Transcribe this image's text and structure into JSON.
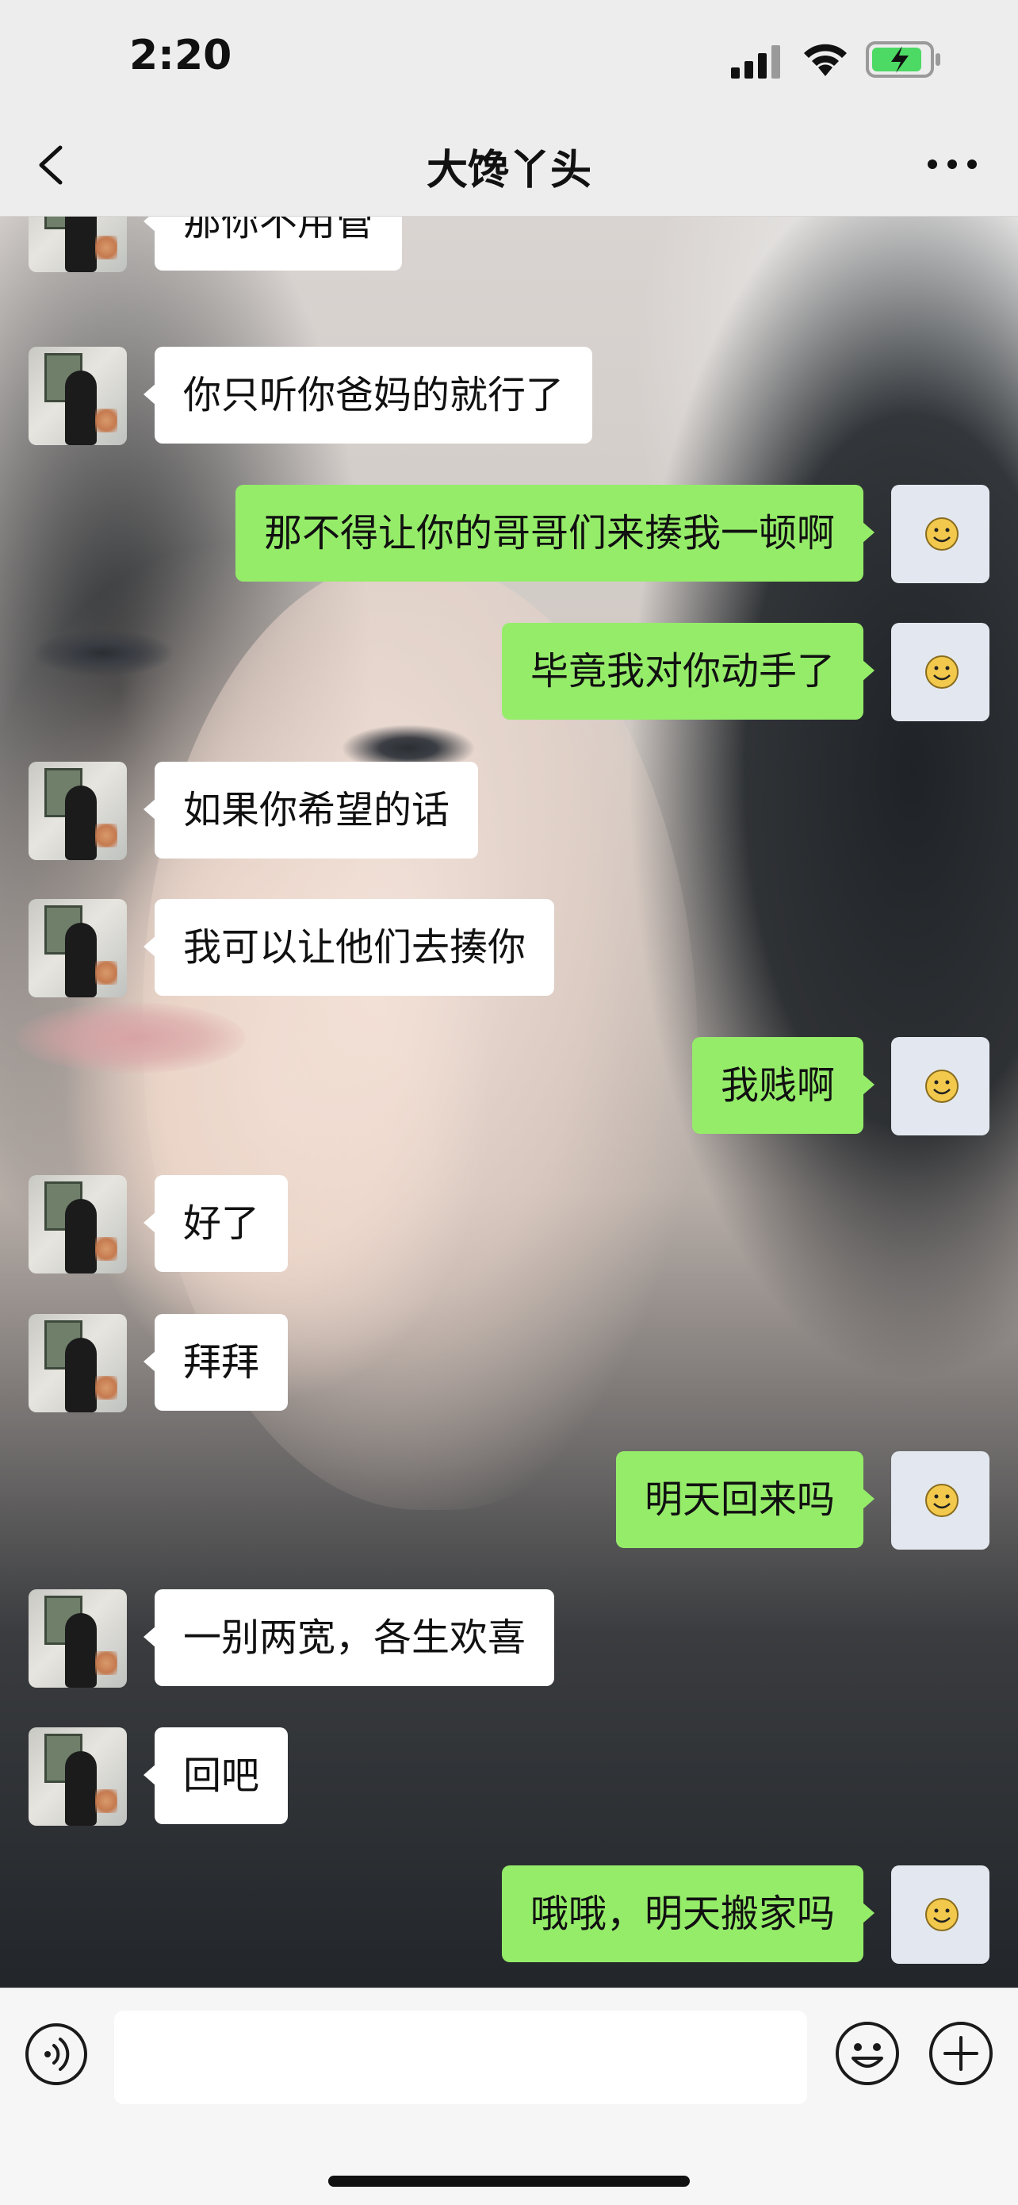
{
  "status_bar": {
    "time": "2:20"
  },
  "header": {
    "title": "大馋丫头"
  },
  "messages": [
    {
      "side": "theirs",
      "text": "那你不用管"
    },
    {
      "side": "theirs",
      "text": "你只听你爸妈的就行了"
    },
    {
      "side": "mine",
      "text": "那不得让你的哥哥们来揍我一顿啊"
    },
    {
      "side": "mine",
      "text": "毕竟我对你动手了"
    },
    {
      "side": "theirs",
      "text": "如果你希望的话"
    },
    {
      "side": "theirs",
      "text": "我可以让他们去揍你"
    },
    {
      "side": "mine",
      "text": "我贱啊"
    },
    {
      "side": "theirs",
      "text": "好了"
    },
    {
      "side": "theirs",
      "text": "拜拜"
    },
    {
      "side": "mine",
      "text": "明天回来吗"
    },
    {
      "side": "theirs",
      "text": "一别两宽，各生欢喜"
    },
    {
      "side": "theirs",
      "text": "回吧"
    },
    {
      "side": "mine",
      "text": "哦哦，明天搬家吗"
    }
  ],
  "input": {
    "value": "",
    "placeholder": ""
  },
  "colors": {
    "mine_bubble": "#95ec69",
    "theirs_bubble": "#ffffff",
    "bar_bg": "#ededed"
  },
  "icons": [
    "back-icon",
    "more-icon",
    "signal-icon",
    "wifi-icon",
    "battery-icon",
    "voice-icon",
    "emoji-icon",
    "plus-icon"
  ]
}
